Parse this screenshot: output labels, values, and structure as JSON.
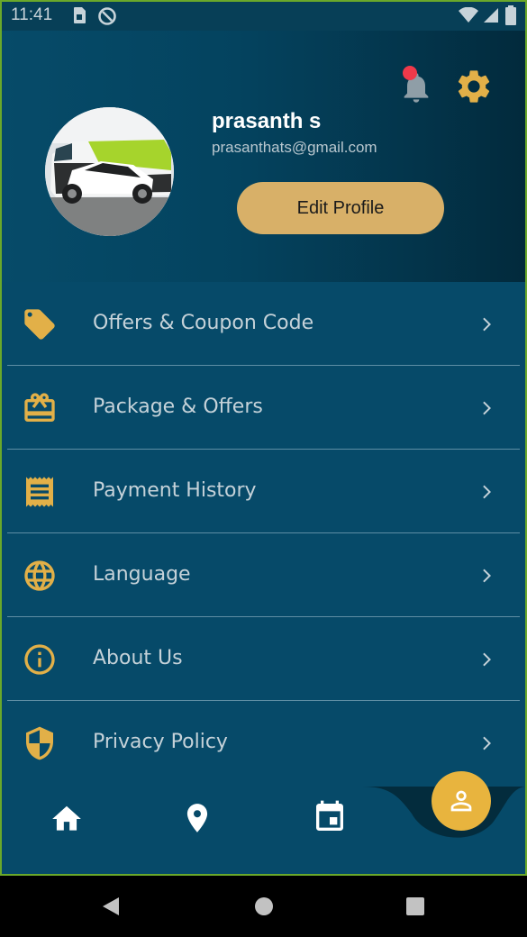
{
  "status_bar": {
    "time": "11:41"
  },
  "header": {
    "user_name": "prasanth s",
    "user_email": "prasanthats@gmail.com",
    "edit_profile_label": "Edit Profile",
    "notification_dot_color": "#f0394a",
    "accent_color": "#d8b068"
  },
  "menu": {
    "items": [
      {
        "label": "Offers & Coupon Code",
        "icon": "tag-icon"
      },
      {
        "label": "Package & Offers",
        "icon": "gift-card-icon"
      },
      {
        "label": "Payment History",
        "icon": "receipt-icon"
      },
      {
        "label": "Language",
        "icon": "globe-icon"
      },
      {
        "label": "About Us",
        "icon": "info-icon"
      },
      {
        "label": "Privacy Policy",
        "icon": "shield-icon"
      }
    ]
  },
  "bottom_nav": {
    "items": [
      {
        "icon": "home-icon"
      },
      {
        "icon": "location-pin-icon"
      },
      {
        "icon": "calendar-icon"
      },
      {
        "icon": "profile-icon",
        "active": true
      }
    ]
  }
}
